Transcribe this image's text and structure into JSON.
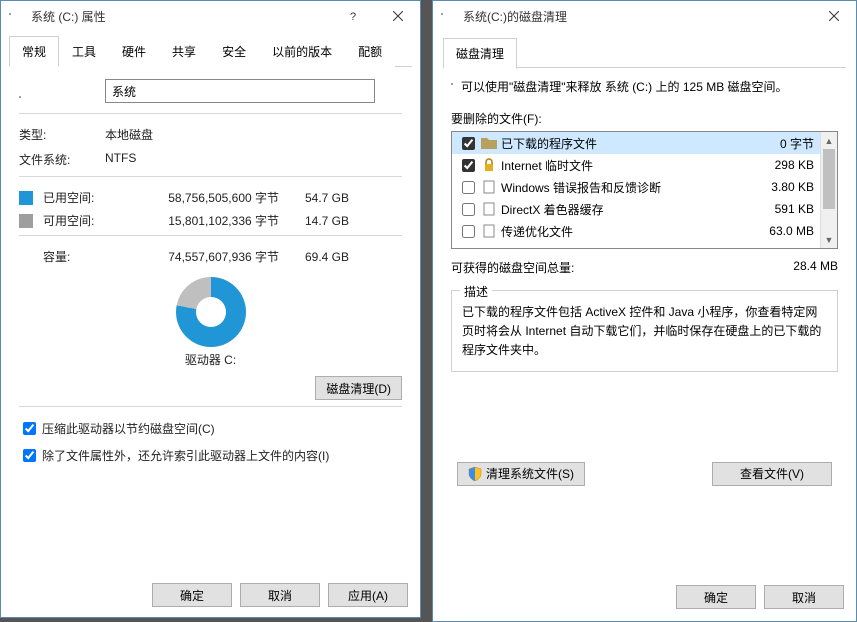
{
  "props": {
    "title": "系统 (C:) 属性",
    "tabs": [
      "常规",
      "工具",
      "硬件",
      "共享",
      "安全",
      "以前的版本",
      "配额"
    ],
    "name_value": "系统",
    "type_label": "类型:",
    "type_value": "本地磁盘",
    "fs_label": "文件系统:",
    "fs_value": "NTFS",
    "used_label": "已用空间:",
    "used_bytes": "58,756,505,600 字节",
    "used_gb": "54.7 GB",
    "free_label": "可用空间:",
    "free_bytes": "15,801,102,336 字节",
    "free_gb": "14.7 GB",
    "cap_label": "容量:",
    "cap_bytes": "74,557,607,936 字节",
    "cap_gb": "69.4 GB",
    "drive_caption": "驱动器 C:",
    "cleanup_btn": "磁盘清理(D)",
    "compress_chk": "压缩此驱动器以节约磁盘空间(C)",
    "index_chk": "除了文件属性外，还允许索引此驱动器上文件的内容(I)",
    "ok": "确定",
    "cancel": "取消",
    "apply": "应用(A)"
  },
  "cleanup": {
    "title": "系统(C:)的磁盘清理",
    "tab": "磁盘清理",
    "intro": "可以使用\"磁盘清理\"来释放 系统 (C:) 上的 125 MB 磁盘空间。",
    "list_label": "要删除的文件(F):",
    "files": [
      {
        "name": "已下载的程序文件",
        "size": "0 字节",
        "checked": true,
        "selected": true,
        "icon": "folder"
      },
      {
        "name": "Internet 临时文件",
        "size": "298 KB",
        "checked": true,
        "selected": false,
        "icon": "lock"
      },
      {
        "name": "Windows 错误报告和反馈诊断",
        "size": "3.80 KB",
        "checked": false,
        "selected": false,
        "icon": "blank"
      },
      {
        "name": "DirectX 着色器缓存",
        "size": "591 KB",
        "checked": false,
        "selected": false,
        "icon": "blank"
      },
      {
        "name": "传递优化文件",
        "size": "63.0 MB",
        "checked": false,
        "selected": false,
        "icon": "blank"
      }
    ],
    "total_label": "可获得的磁盘空间总量:",
    "total_value": "28.4 MB",
    "desc_title": "描述",
    "desc_text": "已下载的程序文件包括 ActiveX 控件和 Java 小程序，你查看特定网页时将会从 Internet 自动下载它们，并临时保存在硬盘上的已下载的程序文件夹中。",
    "clean_sys": "清理系统文件(S)",
    "view_files": "查看文件(V)",
    "ok": "确定",
    "cancel": "取消"
  }
}
